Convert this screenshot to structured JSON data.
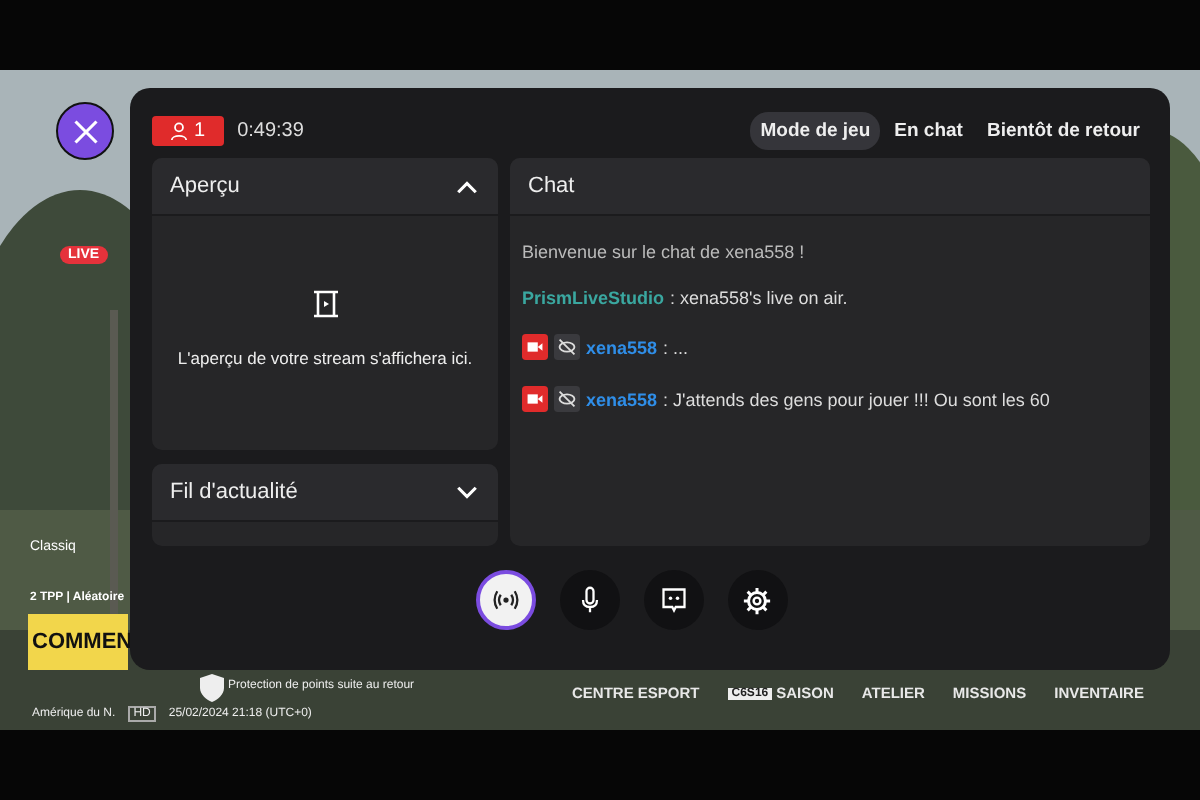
{
  "game_hud": {
    "live_badge": "LIVE",
    "mode_title": "Classiq",
    "mode_info": "2 TPP | Aléatoire",
    "start_button": "COMMEN",
    "protection": "Protection de points suite au retour",
    "region": "Amérique du N.",
    "quality": "HD",
    "datetime": "25/02/2024 21:18 (UTC+0)",
    "nav": [
      {
        "label": "CENTRE ESPORT"
      },
      {
        "label": "SAISON",
        "badge": "C6S16"
      },
      {
        "label": "ATELIER"
      },
      {
        "label": "MISSIONS"
      },
      {
        "label": "INVENTAIRE"
      }
    ]
  },
  "panel": {
    "viewers": "1",
    "elapsed": "0:49:39",
    "modes": [
      {
        "label": "Mode de jeu",
        "selected": true
      },
      {
        "label": "En chat",
        "selected": false
      },
      {
        "label": "Bientôt de retour",
        "selected": false
      }
    ],
    "preview": {
      "title": "Aperçu",
      "expanded": true,
      "message": "L'aperçu de votre stream s'affichera ici."
    },
    "feed": {
      "title": "Fil d'actualité",
      "expanded": false
    },
    "chat": {
      "title": "Chat",
      "messages": [
        {
          "kind": "system",
          "text": "Bienvenue sur le chat de xena558 !"
        },
        {
          "kind": "bot",
          "author": "PrismLiveStudio",
          "text": ": xena558's live on air."
        },
        {
          "kind": "user",
          "author": "xena558",
          "text": ": ..."
        },
        {
          "kind": "user",
          "author": "xena558",
          "text": ": J'attends des gens pour jouer !!! Ou sont les 60"
        }
      ]
    },
    "controls": [
      {
        "kind": "broadcast",
        "selected": true
      },
      {
        "kind": "mic",
        "selected": false
      },
      {
        "kind": "chat",
        "selected": false
      },
      {
        "kind": "settings",
        "selected": false
      }
    ]
  }
}
